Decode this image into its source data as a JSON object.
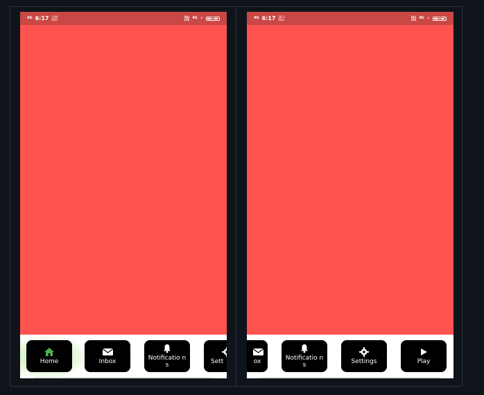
{
  "colors": {
    "accent": "#ff534f",
    "status_bar": "#c94744",
    "nav_button": "#000000",
    "active_icon": "#4caf50",
    "background": "#0f141b"
  },
  "left_phone": {
    "status": {
      "network": "4G",
      "time": "6:17",
      "speed": "3.90\nKB/s",
      "volte": "Vo)\nLTE",
      "network_right": "4G",
      "battery": "82"
    },
    "nav": [
      {
        "label": "Home",
        "icon": "home-icon",
        "active": true
      },
      {
        "label": "Inbox",
        "icon": "mail-icon",
        "active": false
      },
      {
        "label": "Notificatio ns",
        "icon": "bell-icon",
        "active": false
      },
      {
        "label": "Sett",
        "icon": "gear-icon",
        "active": false
      }
    ]
  },
  "right_phone": {
    "status": {
      "network": "4G",
      "time": "6:17",
      "speed": "26.3\nKB/s",
      "volte": "Vo)\nLTE",
      "network_right": "4G",
      "battery": "82"
    },
    "nav": [
      {
        "label": "ox",
        "icon": "mail-icon",
        "active": false
      },
      {
        "label": "Notificatio ns",
        "icon": "bell-icon",
        "active": false
      },
      {
        "label": "Settings",
        "icon": "gear-icon",
        "active": false
      },
      {
        "label": "Play",
        "icon": "play-icon",
        "active": false
      }
    ]
  }
}
